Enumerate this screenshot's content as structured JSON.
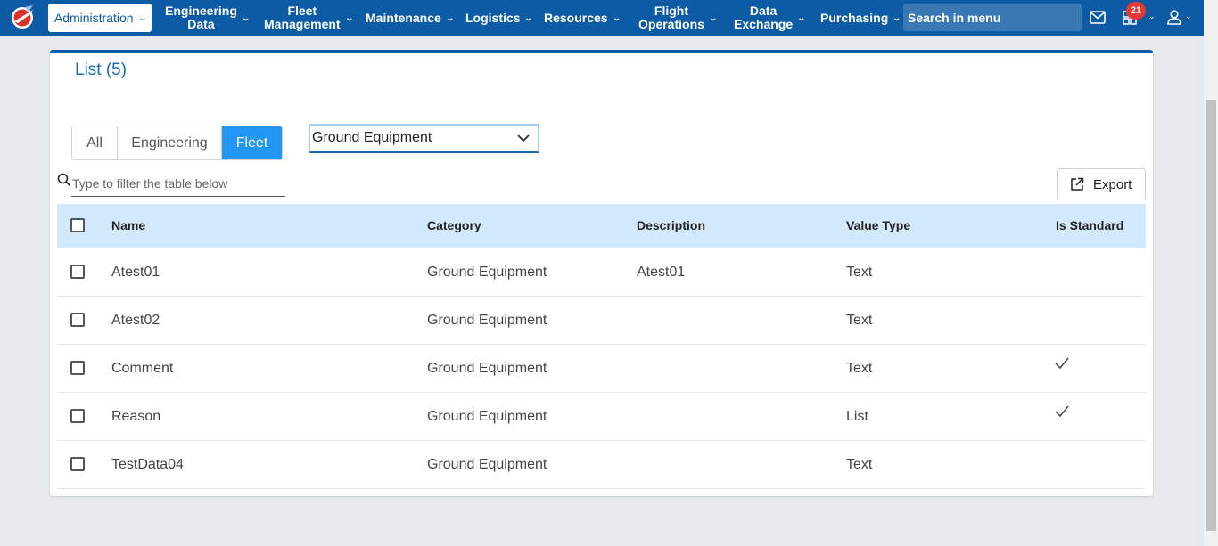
{
  "nav": {
    "admin": "Administration",
    "engineering": "Engineering\nData",
    "fleet": "Fleet\nManagement",
    "maintenance": "Maintenance",
    "logistics": "Logistics",
    "resources": "Resources",
    "flight_ops": "Flight\nOperations",
    "data_exchange": "Data\nExchange",
    "purchasing": "Purchasing",
    "search_placeholder": "Search in menu",
    "notification_count": "21"
  },
  "panel": {
    "title": "List (5)"
  },
  "tabs": [
    "All",
    "Engineering",
    "Fleet"
  ],
  "active_tab": "Fleet",
  "category_select": "Ground Equipment",
  "filter_placeholder": "Type to filter the table below",
  "export_label": "Export",
  "table": {
    "headers": [
      "Name",
      "Category",
      "Description",
      "Value Type",
      "Is Standard"
    ],
    "rows": [
      {
        "name": "Atest01",
        "category": "Ground Equipment",
        "description": "Atest01",
        "value_type": "Text",
        "is_standard": false
      },
      {
        "name": "Atest02",
        "category": "Ground Equipment",
        "description": "",
        "value_type": "Text",
        "is_standard": false
      },
      {
        "name": "Comment",
        "category": "Ground Equipment",
        "description": "",
        "value_type": "Text",
        "is_standard": true
      },
      {
        "name": "Reason",
        "category": "Ground Equipment",
        "description": "",
        "value_type": "List",
        "is_standard": true
      },
      {
        "name": "TestData04",
        "category": "Ground Equipment",
        "description": "",
        "value_type": "Text",
        "is_standard": false
      }
    ]
  },
  "colors": {
    "brand": "#0d5ba4",
    "active_tab": "#2196f3",
    "table_header": "#d2e9fb",
    "badge": "#e53935"
  }
}
